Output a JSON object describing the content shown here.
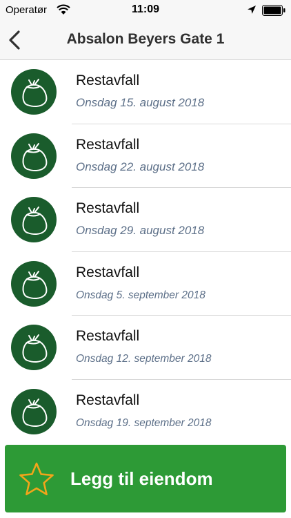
{
  "status_bar": {
    "carrier": "Operatør",
    "time": "11:09"
  },
  "nav": {
    "title": "Absalon Beyers Gate 1"
  },
  "pickups": [
    {
      "type": "Restavfall",
      "date": "Onsdag 15. august 2018"
    },
    {
      "type": "Restavfall",
      "date": "Onsdag 22. august 2018"
    },
    {
      "type": "Restavfall",
      "date": "Onsdag 29. august 2018"
    },
    {
      "type": "Restavfall",
      "date": "Onsdag 5. september 2018"
    },
    {
      "type": "Restavfall",
      "date": "Onsdag 12. september 2018"
    },
    {
      "type": "Restavfall",
      "date": "Onsdag 19. september 2018"
    }
  ],
  "cta": {
    "label": "Legg til eiendom"
  },
  "icons": {
    "waste": "trash-bag-icon",
    "cta": "star-icon"
  },
  "colors": {
    "icon_bg": "#1a5c2c",
    "cta_bg": "#2d9a36",
    "star": "#f2a51a",
    "date_text": "#5c6f88"
  }
}
